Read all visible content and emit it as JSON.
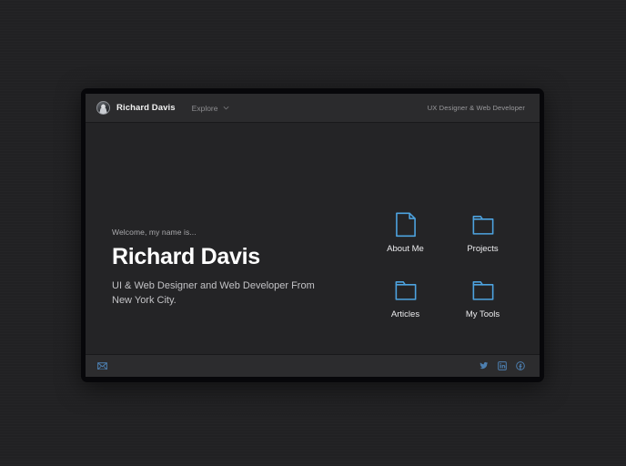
{
  "theme": {
    "accent": "#4da3e0",
    "desktop_bg": "#212123",
    "window_bg": "#242426",
    "header_bg": "#2b2b2d",
    "footer_bg": "#2c2c2e",
    "frame": "#07070a",
    "heading_text": "#ffffff",
    "muted_text": "#9a9a9d"
  },
  "header": {
    "avatar": "user-avatar",
    "brand_name": "Richard Davis",
    "explore_label": "Explore",
    "explore_chevron": "chevron-down-icon",
    "role": "UX Designer & Web Developer"
  },
  "main": {
    "welcome": "Welcome, my name is...",
    "hero_name": "Richard Davis",
    "tagline": "UI & Web Designer and Web Developer From New York City.",
    "links": [
      {
        "label": "About Me",
        "icon": "document-icon"
      },
      {
        "label": "Projects",
        "icon": "folder-icon"
      },
      {
        "label": "Articles",
        "icon": "folder-icon"
      },
      {
        "label": "My Tools",
        "icon": "folder-icon"
      }
    ]
  },
  "footer": {
    "mail": "envelope-icon",
    "socials": [
      {
        "name": "twitter-icon"
      },
      {
        "name": "linkedin-icon"
      },
      {
        "name": "facebook-icon"
      }
    ]
  }
}
